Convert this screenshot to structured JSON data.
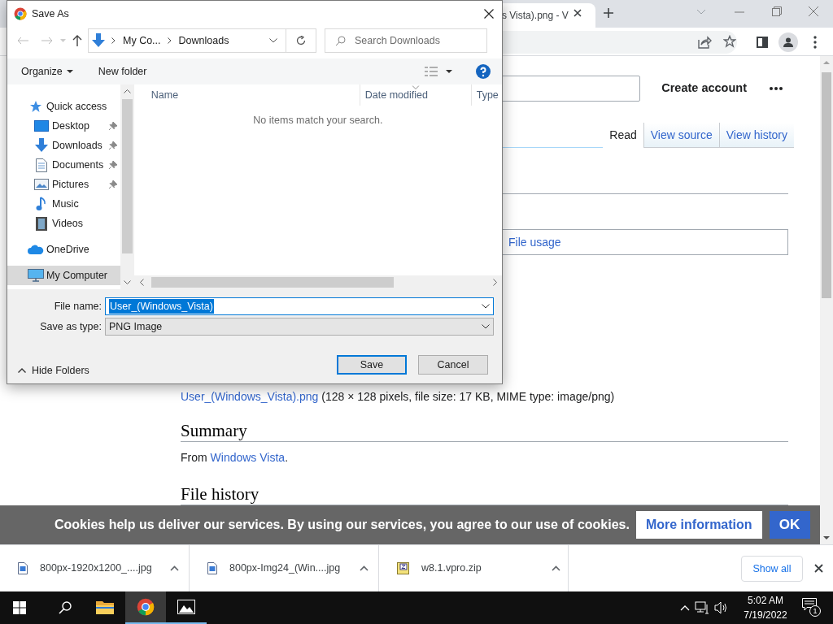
{
  "browser": {
    "tab_title": "s Vista).png - V"
  },
  "page": {
    "create_account": "Create account",
    "tabs": [
      {
        "label": "Read",
        "selected": true
      },
      {
        "label": "View source",
        "selected": false
      },
      {
        "label": "View history",
        "selected": false
      }
    ],
    "file_usage": "File usage",
    "file_link": "User_(Windows_Vista).png",
    "file_info": "(128 × 128 pixels, file size: 17 KB, MIME type: image/png)",
    "summary_heading": "Summary",
    "summary_prefix": "From",
    "summary_link": "Windows Vista",
    "summary_suffix": ".",
    "history_heading": "File history",
    "cookie_text": "Cookies help us deliver our services. By using our services, you agree to our use of cookies.",
    "cookie_more": "More information",
    "cookie_ok": "OK"
  },
  "dialog": {
    "title": "Save As",
    "path": [
      "My Co...",
      "Downloads"
    ],
    "search_placeholder": "Search Downloads",
    "organize": "Organize",
    "new_folder": "New folder",
    "nav": [
      {
        "label": "Quick access",
        "kind": "star",
        "selected": false,
        "children": [
          {
            "label": "Desktop",
            "kind": "desktop",
            "pinned": true,
            "selected": false
          },
          {
            "label": "Downloads",
            "kind": "download",
            "pinned": true,
            "selected": false
          },
          {
            "label": "Documents",
            "kind": "document",
            "pinned": true,
            "selected": false
          },
          {
            "label": "Pictures",
            "kind": "picture",
            "pinned": true,
            "selected": false
          },
          {
            "label": "Music",
            "kind": "music",
            "pinned": false,
            "selected": false
          },
          {
            "label": "Videos",
            "kind": "video",
            "pinned": false,
            "selected": false
          }
        ]
      },
      {
        "label": "OneDrive",
        "kind": "cloud",
        "selected": false
      },
      {
        "label": "My Computer",
        "kind": "computer",
        "selected": true
      }
    ],
    "columns": [
      {
        "label": "Name",
        "sorted": false
      },
      {
        "label": "Date modified",
        "sorted": true
      },
      {
        "label": "Type",
        "sorted": false
      }
    ],
    "empty_message": "No items match your search.",
    "file_name_label": "File name:",
    "file_name": "User_(Windows_Vista)",
    "file_name_selected": true,
    "type_label": "Save as type:",
    "type_value": "PNG Image",
    "hide_folders": "Hide Folders",
    "buttons": [
      {
        "label": "Save",
        "default": true
      },
      {
        "label": "Cancel",
        "default": false
      }
    ]
  },
  "downloads": {
    "items": [
      {
        "name": "800px-1920x1200_....jpg",
        "kind": "image"
      },
      {
        "name": "800px-Img24_(Win....jpg",
        "kind": "image"
      },
      {
        "name": "w8.1.vpro.zip",
        "kind": "archive"
      }
    ],
    "show_all": "Show all"
  },
  "taskbar": {
    "apps": [
      {
        "kind": "folder",
        "active": false,
        "running": false
      },
      {
        "kind": "browser",
        "active": true,
        "running": true
      },
      {
        "kind": "photos",
        "active": false,
        "running": true
      }
    ],
    "time": "5:02 AM",
    "date": "7/19/2022",
    "notifications": "1"
  }
}
